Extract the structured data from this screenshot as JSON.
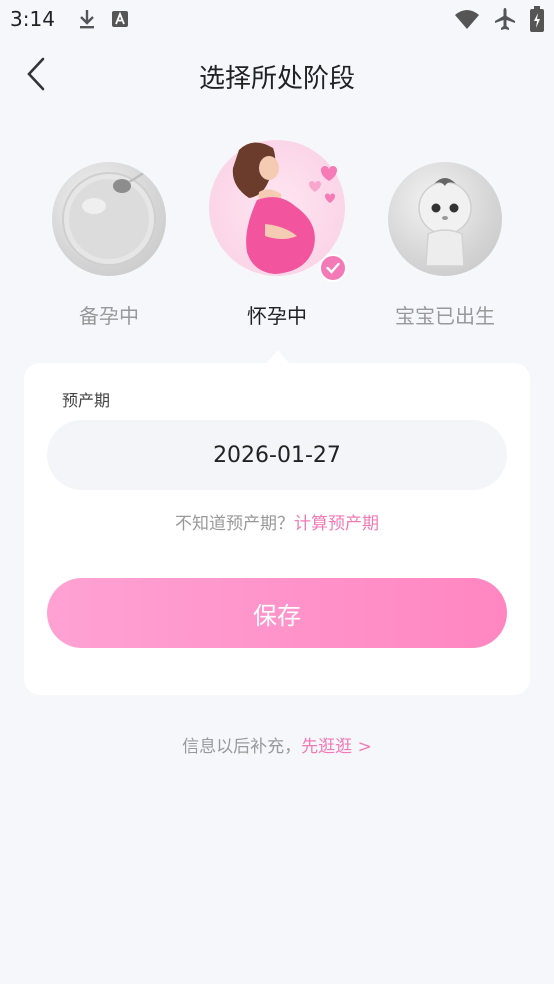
{
  "status": {
    "time": "3:14",
    "icons": [
      "download-icon",
      "font-icon",
      "wifi-icon",
      "airplane-icon",
      "battery-icon"
    ]
  },
  "header": {
    "title": "选择所处阶段",
    "back_icon": "back-arrow-icon"
  },
  "stages": [
    {
      "label": "备孕中",
      "selected": false,
      "icon": "sperm-egg-icon"
    },
    {
      "label": "怀孕中",
      "selected": true,
      "icon": "pregnant-woman-icon"
    },
    {
      "label": "宝宝已出生",
      "selected": false,
      "icon": "baby-icon"
    }
  ],
  "form": {
    "due_date_label": "预产期",
    "due_date_value": "2026-01-27",
    "hint_text": "不知道预产期？",
    "hint_link": "计算预产期",
    "save_label": "保存"
  },
  "footer": {
    "text": "信息以后补充，",
    "link": "先逛逛 >"
  },
  "colors": {
    "accent": "#f37ab6",
    "button_start": "#ffa2d3",
    "button_end": "#ff86c1",
    "background": "#f6f7fb"
  }
}
